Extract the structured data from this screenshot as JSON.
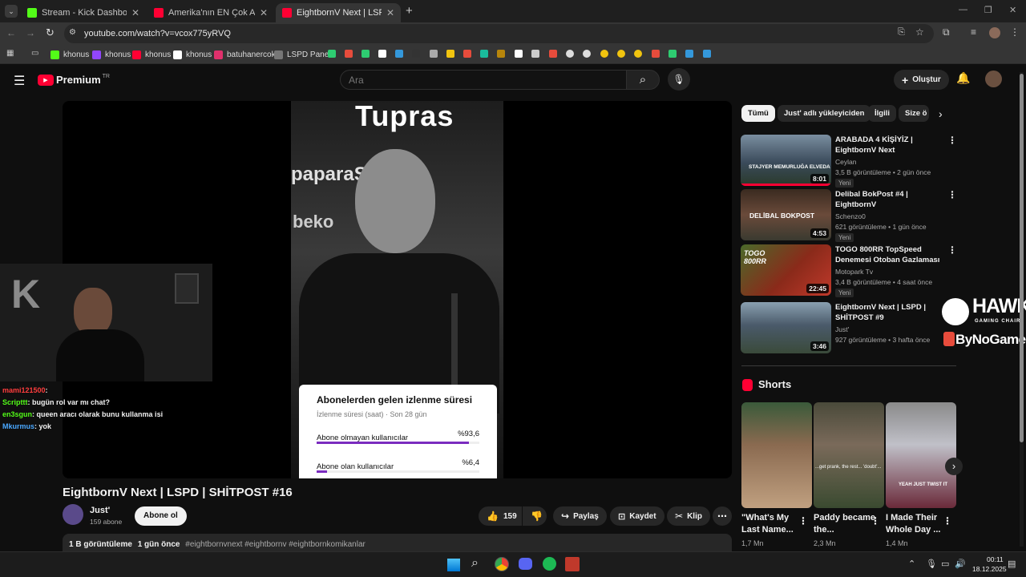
{
  "browser": {
    "tabs": [
      {
        "title": "Stream - Kick Dashboard",
        "fav_color": "#53fc18"
      },
      {
        "title": "Amerika'nın EN Çok Aranan Sür",
        "fav_color": "#ff0033"
      },
      {
        "title": "EightbornV Next | LSPD | SHİTP",
        "fav_color": "#ff0033"
      }
    ],
    "new_tab": "+",
    "url": "youtube.com/watch?v=vcox775yRVQ",
    "bookmarks": [
      {
        "label": "khonus",
        "color": "#53fc18"
      },
      {
        "label": "khonus",
        "color": "#9146ff"
      },
      {
        "label": "khonus",
        "color": "#ff0033"
      },
      {
        "label": "khonus",
        "color": "#ffffff"
      },
      {
        "label": "batuhanercok",
        "color": "#e1306c"
      },
      {
        "label": "LSPD Panel",
        "color": "#888888"
      }
    ]
  },
  "yt": {
    "logo_text": "Premium",
    "logo_region": "TR",
    "search_placeholder": "Ara",
    "create_label": "Oluştur"
  },
  "video": {
    "title": "EightbornV Next | LSPD | SHİTPOST #16",
    "brand_text": "Tupras",
    "brand_text2": "paparaSHA",
    "brand_text3": "beko",
    "stats_card": {
      "title": "Abonelerden gelen izlenme süresi",
      "subtitle": "İzlenme süresi (saat) · Son 28 gün",
      "rows": [
        {
          "label": "Abone olmayan kullanıcılar",
          "value": "%93,6",
          "fraction": 0.936
        },
        {
          "label": "Abone olan kullanıcılar",
          "value": "%6,4",
          "fraction": 0.064
        }
      ]
    },
    "channel_name": "Just'",
    "subscribers": "159 abone",
    "subscribe_label": "Abone ol",
    "likes": "159",
    "share_label": "Paylaş",
    "save_label": "Kaydet",
    "clip_label": "Klip",
    "views": "1 B görüntüleme",
    "published": "1 gün önce",
    "tags": "#eightbornvnext #eightbornv #eightbornkomikanlar"
  },
  "chat": [
    {
      "user": "mami121500",
      "msg": "",
      "color": "#ff3d3d"
    },
    {
      "user": "Scripttt",
      "msg": "bugün rol var mı chat?",
      "color": "#53fc18"
    },
    {
      "user": "en3sgun",
      "msg": "queen aracı olarak bunu kullanma isi",
      "color": "#53fc18"
    },
    {
      "user": "Mkurmus",
      "msg": "yok",
      "color": "#4aa8ff"
    }
  ],
  "chips": [
    "Tümü",
    "Just' adlı yükleyiciden",
    "İlgili",
    "Size ö"
  ],
  "related": [
    {
      "title": "ARABADA 4 KİŞİYİZ | EightbornV Next",
      "channel": "Ceylan",
      "meta": "3,5 B görüntüleme • 2 gün önce",
      "badge": "Yeni",
      "duration": "8:01",
      "thumb_text": "STAJYER MEMURLUĞA ELVEDA",
      "color": "#3a4a5a"
    },
    {
      "title": "Delibal BokPost #4 | EightbornV",
      "channel": "Schenzo0",
      "meta": "621 görüntüleme • 1 gün önce",
      "badge": "Yeni",
      "duration": "4:53",
      "thumb_text": "DELİBAL BOKPOST",
      "color": "#4a3a30"
    },
    {
      "title": "TOGO 800RR TopSpeed Denemesi  Otoban Gazlaması ...",
      "channel": "Motopark Tv",
      "meta": "3,4 B görüntüleme • 4 saat önce",
      "badge": "Yeni",
      "duration": "22:45",
      "thumb_text": "TOGO 800RR",
      "color": "#6a2a1a"
    },
    {
      "title": "EightbornV Next | LSPD | SHİTPOST #9",
      "channel": "Just'",
      "meta": "927 görüntüleme • 3 hafta önce",
      "badge": "",
      "duration": "3:46",
      "thumb_text": "",
      "color": "#4a5a6a"
    }
  ],
  "overlay": {
    "brand1": "HAWK",
    "brand1_sub": "GAMING CHAIR",
    "brand2": "ByNoGame"
  },
  "shorts": {
    "heading": "Shorts",
    "items": [
      {
        "title": "\"What's My Last Name...",
        "views": "1,7 Mn",
        "color": "#8a6a50"
      },
      {
        "title": "Paddy became the...",
        "views": "2,3 Mn",
        "color": "#6a7a5a",
        "caption": "...get prank, the rest... 'doubt'..."
      },
      {
        "title": "I Made Their Whole Day ...",
        "views": "1,4 Mn",
        "color": "#9a9aa0",
        "caption": "YEAH JUST TWIST IT"
      }
    ]
  },
  "clock": {
    "time": "00:11",
    "date": "18.12.2025"
  }
}
